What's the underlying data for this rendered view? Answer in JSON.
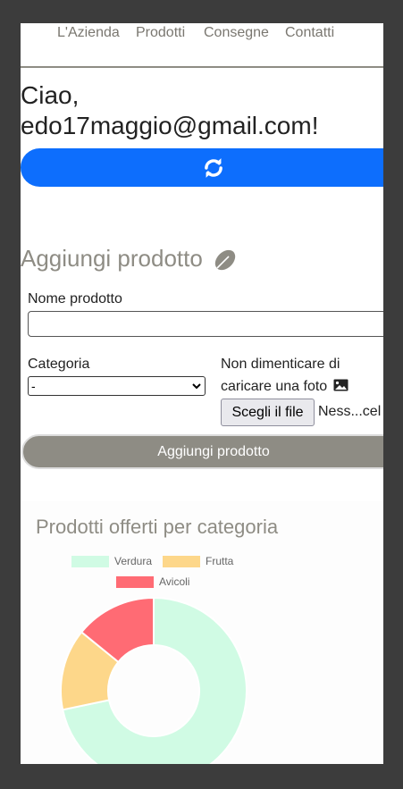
{
  "nav": {
    "items": [
      "L'Azienda",
      "Prodotti",
      "Consegne",
      "Contatti"
    ]
  },
  "greeting": "Ciao, edo17maggio@gmail.com!",
  "refresh_button": {
    "icon": "refresh-icon",
    "color": "#0d6efd"
  },
  "add_product": {
    "title": "Aggiungi prodotto",
    "title_icon": "leaf-icon",
    "name_label": "Nome prodotto",
    "name_value": "",
    "category_label": "Categoria",
    "category_selected": "-",
    "photo_label_line1": "Non dimenticare di",
    "photo_label_line2": "caricare una foto",
    "photo_icon": "image-icon",
    "file_button": "Scegli il file",
    "file_name": "Ness...cel",
    "submit": "Aggiungi prodotto"
  },
  "chart_title": "Prodotti offerti per categoria",
  "chart_data": {
    "type": "pie",
    "donut": true,
    "categories": [
      "Verdura",
      "Frutta",
      "Avicoli"
    ],
    "values": [
      71,
      14,
      14
    ],
    "colors": [
      "#d0fbe4",
      "#fdd78a",
      "#ff6b74"
    ],
    "legend_position": "top"
  },
  "colors": {
    "accent": "#0d6efd",
    "muted": "#8e8c84"
  }
}
